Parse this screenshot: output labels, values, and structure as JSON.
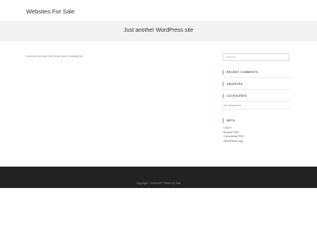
{
  "header": {
    "site_title": "Websites For Sale",
    "tagline": "Just another WordPress site"
  },
  "main": {
    "not_found_text": "It seems we can't find what you're looking for."
  },
  "sidebar": {
    "search_placeholder": "Search",
    "recent_comments_title": "RECENT COMMENTS",
    "archives_title": "ARCHIVES",
    "categories_title": "CATEGORIES",
    "no_categories": "No categories",
    "meta_title": "META",
    "meta_links": [
      "Log in",
      "Entries RSS",
      "Comments RSS",
      "WordPress.org"
    ]
  },
  "footer": {
    "copyright": "Copyright - OceanWP Theme by Nick"
  },
  "colors": {
    "accent": "#3fb6d6",
    "footer_bg": "#222222",
    "tagline_bg": "#f2f2f2"
  }
}
